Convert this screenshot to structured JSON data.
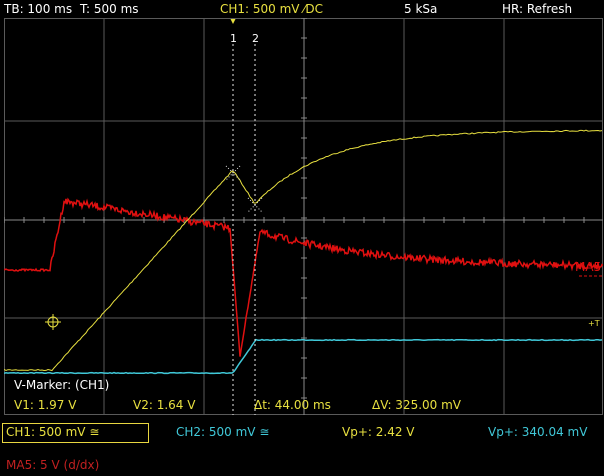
{
  "topbar": {
    "timebase": "TB: 100 ms",
    "trigger_time": "T: 500 ms",
    "channel": "CH1: 500 mV ⁄DC",
    "sample_rate": "5 kSa",
    "mode": "HR: Refresh"
  },
  "markers": {
    "m1": "1",
    "m2": "2"
  },
  "trace_labels": {
    "math": "MA5",
    "ch_ref": "+T"
  },
  "measurement": {
    "title": "V-Marker: (CH1)",
    "v1": "V1: 1.97 V",
    "v2": "V2: 1.64 V",
    "dt": "Δt: 44.00 ms",
    "dv": "ΔV: 325.00 mV"
  },
  "bottom": {
    "ch1": "CH1: 500 mV ≅",
    "ch2": "CH2: 500 mV ≅",
    "vp_ch1": "Vp+: 2.42 V",
    "vp_ch2": "Vp+: 340.04 mV",
    "ma5": "MA5: 5 V (d/dx)"
  },
  "colors": {
    "ch1": "#e8e040",
    "ch2": "#40c8d8",
    "math": "#e01010",
    "grid": "#5a5a5a",
    "measure_text": "#e8e040",
    "ch2_text": "#40c8d8",
    "ma5_text": "#c02020"
  }
}
